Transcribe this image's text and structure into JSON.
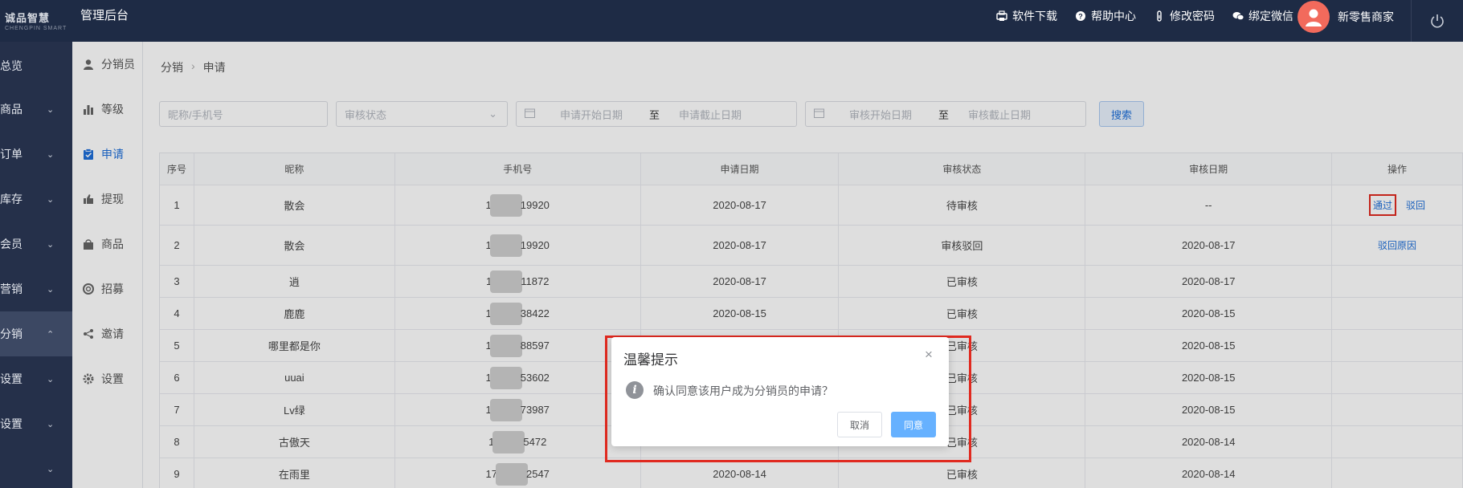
{
  "header": {
    "logo_text": "诚品智慧",
    "app_title": "管理后台",
    "actions": [
      {
        "label": "软件下载",
        "icon": "download-icon"
      },
      {
        "label": "帮助中心",
        "icon": "help-icon"
      },
      {
        "label": "修改密码",
        "icon": "key-icon"
      },
      {
        "label": "绑定微信",
        "icon": "wechat-icon"
      }
    ],
    "user_name": "新零售商家"
  },
  "sidebar": {
    "items": [
      {
        "label": "总览"
      },
      {
        "label": "商品"
      },
      {
        "label": "订单"
      },
      {
        "label": "库存"
      },
      {
        "label": "会员"
      },
      {
        "label": "营销"
      },
      {
        "label": "分销"
      },
      {
        "label": "系统设置"
      },
      {
        "label": "门店设置"
      },
      {
        "label": ""
      }
    ]
  },
  "subnav": {
    "items": [
      {
        "label": "分销员",
        "icon": "user-icon"
      },
      {
        "label": "等级",
        "icon": "bar-chart-icon"
      },
      {
        "label": "申请",
        "icon": "clipboard-check-icon"
      },
      {
        "label": "提现",
        "icon": "thumbs-up-icon"
      },
      {
        "label": "商品",
        "icon": "shopping-bag-icon"
      },
      {
        "label": "招募",
        "icon": "life-ring-icon"
      },
      {
        "label": "邀请",
        "icon": "share-icon"
      },
      {
        "label": "设置",
        "icon": "gear-icon"
      }
    ]
  },
  "breadcrumb": {
    "parent": "分销",
    "current": "申请"
  },
  "filters": {
    "nickname_placeholder": "昵称/手机号",
    "status_placeholder": "审核状态",
    "apply_start": "申请开始日期",
    "apply_end": "申请截止日期",
    "review_start": "审核开始日期",
    "review_end": "审核截止日期",
    "range_sep": "至",
    "search_label": "搜索"
  },
  "table": {
    "headers": [
      "序号",
      "昵称",
      "手机号",
      "申请日期",
      "审核状态",
      "审核日期",
      "操作"
    ],
    "rows": [
      {
        "no": "1",
        "nick": "散会",
        "phone_head": "1",
        "phone_tail": "19920",
        "apply": "2020-08-17",
        "status": "待审核",
        "review": "--",
        "ops": [
          "通过",
          "驳回"
        ]
      },
      {
        "no": "2",
        "nick": "散会",
        "phone_head": "1",
        "phone_tail": "19920",
        "apply": "2020-08-17",
        "status": "审核驳回",
        "review": "2020-08-17",
        "ops": [
          "驳回原因"
        ]
      },
      {
        "no": "3",
        "nick": "逍",
        "phone_head": "1",
        "phone_tail": "11872",
        "apply": "2020-08-17",
        "status": "已审核",
        "review": "2020-08-17",
        "ops": []
      },
      {
        "no": "4",
        "nick": "鹿鹿",
        "phone_head": "1",
        "phone_tail": "38422",
        "apply": "2020-08-15",
        "status": "已审核",
        "review": "2020-08-15",
        "ops": []
      },
      {
        "no": "5",
        "nick": "哪里都是你",
        "phone_head": "1",
        "phone_tail": "88597",
        "apply": "",
        "status": "已审核",
        "review": "2020-08-15",
        "ops": []
      },
      {
        "no": "6",
        "nick": "uuai",
        "phone_head": "1",
        "phone_tail": "53602",
        "apply": "",
        "status": "已审核",
        "review": "2020-08-15",
        "ops": []
      },
      {
        "no": "7",
        "nick": "Lv绿",
        "phone_head": "1",
        "phone_tail": "73987",
        "apply": "",
        "status": "已审核",
        "review": "2020-08-15",
        "ops": []
      },
      {
        "no": "8",
        "nick": "古傲天",
        "phone_head": "1",
        "phone_tail": "5472",
        "apply": "",
        "status": "已审核",
        "review": "2020-08-14",
        "ops": []
      },
      {
        "no": "9",
        "nick": "在雨里",
        "phone_head": "17",
        "phone_tail": "2547",
        "apply": "2020-08-14",
        "status": "已审核",
        "review": "2020-08-14",
        "ops": []
      }
    ]
  },
  "dialog": {
    "title": "温馨提示",
    "message": "确认同意该用户成为分销员的申请？",
    "cancel_label": "取消",
    "confirm_label": "同意",
    "close_glyph": "×",
    "info_glyph": "i"
  },
  "colors": {
    "header_bg": "#1e2b45",
    "sidebar_bg": "#25304a",
    "accent": "#1e6fd9",
    "highlight": "#e02a20"
  }
}
